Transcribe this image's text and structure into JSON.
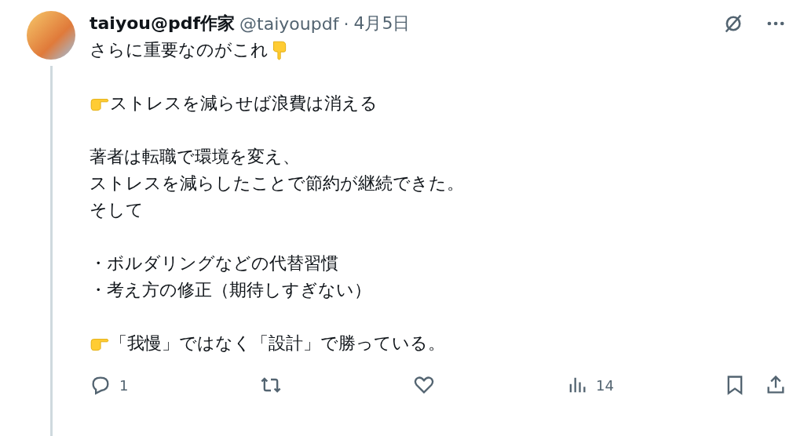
{
  "post": {
    "author_name": "taiyou@pdf作家",
    "handle": "@taiyoupdf",
    "separator": "·",
    "date": "4月5日",
    "paragraphs": [
      [
        {
          "text": "さらに重要なのがこれ",
          "kind": "point-down-after"
        }
      ],
      [
        {
          "text": "ストレスを減らせば浪費は消える",
          "kind": "point-right-before"
        }
      ],
      [
        {
          "text": "著者は転職で環境を変え、",
          "kind": "plain"
        },
        {
          "text": "ストレスを減らしたことで節約が継続できた。",
          "kind": "plain"
        },
        {
          "text": "そして",
          "kind": "plain"
        }
      ],
      [
        {
          "text": "・ボルダリングなどの代替習慣",
          "kind": "plain"
        },
        {
          "text": "・考え方の修正（期待しすぎない）",
          "kind": "plain"
        }
      ],
      [
        {
          "text": "「我慢」ではなく「設計」で勝っている。",
          "kind": "point-right-before"
        }
      ]
    ],
    "actions": [
      {
        "kind": "reply",
        "count": "1"
      },
      {
        "kind": "repost"
      },
      {
        "kind": "like"
      },
      {
        "kind": "views",
        "count": "14"
      }
    ]
  }
}
